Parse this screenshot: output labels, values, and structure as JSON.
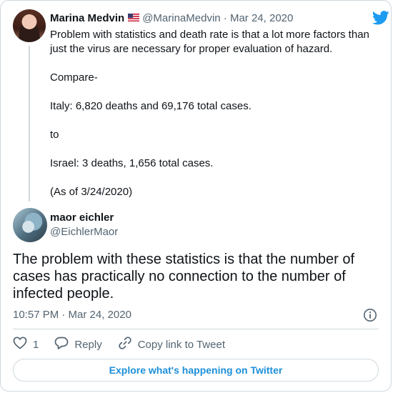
{
  "parent_tweet": {
    "name": "Marina Medvin",
    "flag_icon": "us-flag-icon",
    "handle": "@MarinaMedvin",
    "separator": "·",
    "date": "Mar 24, 2020",
    "paragraphs": [
      "Problem with statistics and death rate is that a lot more factors than just the virus are necessary for proper evaluation of hazard.",
      "Compare-",
      "Italy: 6,820 deaths and 69,176 total cases.",
      "to",
      "Israel: 3 deaths, 1,656 total cases.",
      "(As of 3/24/2020)"
    ]
  },
  "main_tweet": {
    "name": "maor eichler",
    "handle": "@EichlerMaor",
    "text": "The problem with these statistics is that the number of cases has practically no connection to the number of infected people.",
    "timestamp": "10:57 PM · Mar 24, 2020"
  },
  "actions": {
    "like_count": "1",
    "reply_label": "Reply",
    "copy_link_label": "Copy link to Tweet"
  },
  "explore_button": "Explore what's happening on Twitter",
  "colors": {
    "twitter_blue": "#1d9bf0",
    "muted": "#536471",
    "border": "#cfd9de"
  }
}
